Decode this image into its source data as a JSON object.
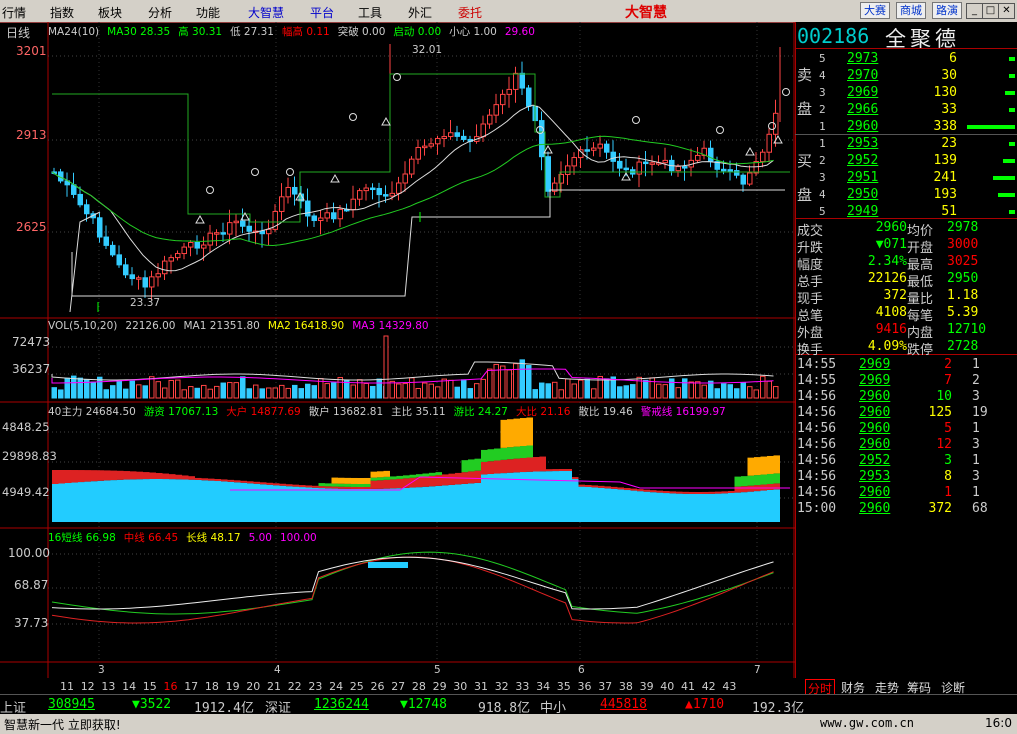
{
  "menu": [
    "行情",
    "指数",
    "板块",
    "分析",
    "功能",
    "大智慧",
    "平台",
    "工具",
    "外汇",
    "委托"
  ],
  "brand": "大智慧",
  "top_buttons": [
    "大赛",
    "商城",
    "路演"
  ],
  "window_buttons": [
    "_",
    "□",
    "✕"
  ],
  "kline": {
    "period": "日线",
    "indicator_line": [
      {
        "t": "MA24(10)",
        "c": "#ccc"
      },
      {
        "t": "MA30 28.35",
        "c": "#0f0"
      },
      {
        "t": "高 30.31",
        "c": "#0f0"
      },
      {
        "t": "低 27.31",
        "c": "#ccc"
      },
      {
        "t": "幅高 0.11",
        "c": "#f00"
      },
      {
        "t": "突破 0.00",
        "c": "#ccc"
      },
      {
        "t": "启动 0.00",
        "c": "#0f0"
      },
      {
        "t": "小心 1.00",
        "c": "#ccc"
      },
      {
        "t": "29.60",
        "c": "#f0f"
      }
    ],
    "y_ticks": [
      "3201",
      "2913",
      "2625"
    ],
    "high_label": "32.01",
    "low_label": "23.37"
  },
  "vol": {
    "label_line": [
      {
        "t": "VOL(5,10,20)",
        "c": "#ccc"
      },
      {
        "t": "22126.00",
        "c": "#ccc"
      },
      {
        "t": "MA1 21351.80",
        "c": "#ccc"
      },
      {
        "t": "MA2 16418.90",
        "c": "#ff0"
      },
      {
        "t": "MA3 14329.80",
        "c": "#f0f"
      }
    ],
    "y_ticks": [
      "72473",
      "36237"
    ]
  },
  "money": {
    "label_line": [
      {
        "t": "40主力 24684.50",
        "c": "#ccc"
      },
      {
        "t": "游资 17067.13",
        "c": "#0f0"
      },
      {
        "t": "大户 14877.69",
        "c": "#f00"
      },
      {
        "t": "散户 13682.81",
        "c": "#ccc"
      },
      {
        "t": "主比 35.11",
        "c": "#ccc"
      },
      {
        "t": "游比 24.27",
        "c": "#0f0"
      },
      {
        "t": "大比 21.16",
        "c": "#f00"
      },
      {
        "t": "散比 19.46",
        "c": "#ccc"
      },
      {
        "t": "警戒线 16199.97",
        "c": "#f0f"
      }
    ],
    "y_ticks": [
      "4848.25",
      "29898.83",
      "4949.42"
    ]
  },
  "osc": {
    "label_line": [
      {
        "t": "16短线 66.98",
        "c": "#0f0"
      },
      {
        "t": "中线 66.45",
        "c": "#f00"
      },
      {
        "t": "长线 48.17",
        "c": "#ff0"
      },
      {
        "t": "5.00",
        "c": "#f0f"
      },
      {
        "t": "100.00",
        "c": "#f0f"
      }
    ],
    "y_ticks": [
      "100.00",
      "68.87",
      "37.73"
    ]
  },
  "x_axis": {
    "months": [
      "3",
      "4",
      "5",
      "6",
      "7"
    ],
    "days": [
      "11",
      "12",
      "13",
      "14",
      "15",
      "16",
      "17",
      "18",
      "19",
      "20",
      "21",
      "22",
      "23",
      "24",
      "25",
      "26",
      "27",
      "28",
      "29",
      "30",
      "31",
      "32",
      "33",
      "34",
      "35",
      "36",
      "37",
      "38",
      "39",
      "40",
      "41",
      "42",
      "43"
    ]
  },
  "quote": {
    "code": "002186",
    "name": "全聚德",
    "sell_label": "卖盘",
    "buy_label": "买盘",
    "sell": [
      {
        "level": "5",
        "price": "2973",
        "vol": "6",
        "bar": 0
      },
      {
        "level": "4",
        "price": "2970",
        "vol": "30",
        "bar": 0
      },
      {
        "level": "3",
        "price": "2969",
        "vol": "130",
        "bar": 10
      },
      {
        "level": "2",
        "price": "2966",
        "vol": "33",
        "bar": 0
      },
      {
        "level": "1",
        "price": "2960",
        "vol": "338",
        "bar": 48
      }
    ],
    "buy": [
      {
        "level": "1",
        "price": "2953",
        "vol": "23",
        "bar": 0
      },
      {
        "level": "2",
        "price": "2952",
        "vol": "139",
        "bar": 12
      },
      {
        "level": "3",
        "price": "2951",
        "vol": "241",
        "bar": 22
      },
      {
        "level": "4",
        "price": "2950",
        "vol": "193",
        "bar": 17
      },
      {
        "level": "5",
        "price": "2949",
        "vol": "51",
        "bar": 0
      }
    ],
    "stats": [
      {
        "k1": "成交",
        "v1": "2960",
        "c1": "#0f0",
        "k2": "均价",
        "v2": "2978",
        "c2": "#0f0"
      },
      {
        "k1": "升跌",
        "v1": "▼071",
        "c1": "#0f0",
        "k2": "开盘",
        "v2": "3000",
        "c2": "#f00"
      },
      {
        "k1": "幅度",
        "v1": "2.34%",
        "c1": "#0f0",
        "k2": "最高",
        "v2": "3025",
        "c2": "#f00"
      },
      {
        "k1": "总手",
        "v1": "22126",
        "c1": "#ff0",
        "k2": "最低",
        "v2": "2950",
        "c2": "#0f0"
      },
      {
        "k1": "现手",
        "v1": "372",
        "c1": "#ff0",
        "k2": "量比",
        "v2": "1.18",
        "c2": "#ff0"
      },
      {
        "k1": "总笔",
        "v1": "4108",
        "c1": "#ff0",
        "k2": "每笔",
        "v2": "5.39",
        "c2": "#ff0"
      },
      {
        "k1": "外盘",
        "v1": "9416",
        "c1": "#f00",
        "k2": "内盘",
        "v2": "12710",
        "c2": "#0f0"
      },
      {
        "k1": "换手",
        "v1": "4.09%",
        "c1": "#ff0",
        "k2": "跌停",
        "v2": "2728",
        "c2": "#0f0"
      }
    ],
    "ticks": [
      {
        "t": "14:55",
        "p": "2969",
        "v": "2",
        "vc": "#f00",
        "n": "1"
      },
      {
        "t": "14:55",
        "p": "2969",
        "v": "7",
        "vc": "#f00",
        "n": "2"
      },
      {
        "t": "14:56",
        "p": "2960",
        "v": "10",
        "vc": "#0f0",
        "n": "3"
      },
      {
        "t": "14:56",
        "p": "2960",
        "v": "125",
        "vc": "#ff0",
        "n": "19"
      },
      {
        "t": "14:56",
        "p": "2960",
        "v": "5",
        "vc": "#f00",
        "n": "1"
      },
      {
        "t": "14:56",
        "p": "2960",
        "v": "12",
        "vc": "#f00",
        "n": "3"
      },
      {
        "t": "14:56",
        "p": "2952",
        "v": "3",
        "vc": "#0f0",
        "n": "1"
      },
      {
        "t": "14:56",
        "p": "2953",
        "v": "8",
        "vc": "#ff0",
        "n": "3"
      },
      {
        "t": "14:56",
        "p": "2960",
        "v": "1",
        "vc": "#f00",
        "n": "1"
      },
      {
        "t": "15:00",
        "p": "2960",
        "v": "372",
        "vc": "#ff0",
        "n": "68"
      }
    ]
  },
  "tabs": [
    "分时",
    "财务",
    "走势",
    "筹码",
    "诊断"
  ],
  "index_bar": {
    "sh_label": "上证",
    "sh_value": "308945",
    "sh_change": "▼3522",
    "sh_amount": "1912.4亿",
    "sz_label": "深证",
    "sz_value": "1236244",
    "sz_change": "▼12748",
    "sz_amount": "918.8亿",
    "zx_label": "中小",
    "zx_value": "445818",
    "zx_change": "▲1710",
    "zx_amount": "192.3亿"
  },
  "status": {
    "left": "智慧新一代 立即获取!",
    "url": "www.gw.com.cn",
    "clock": "16:0"
  }
}
